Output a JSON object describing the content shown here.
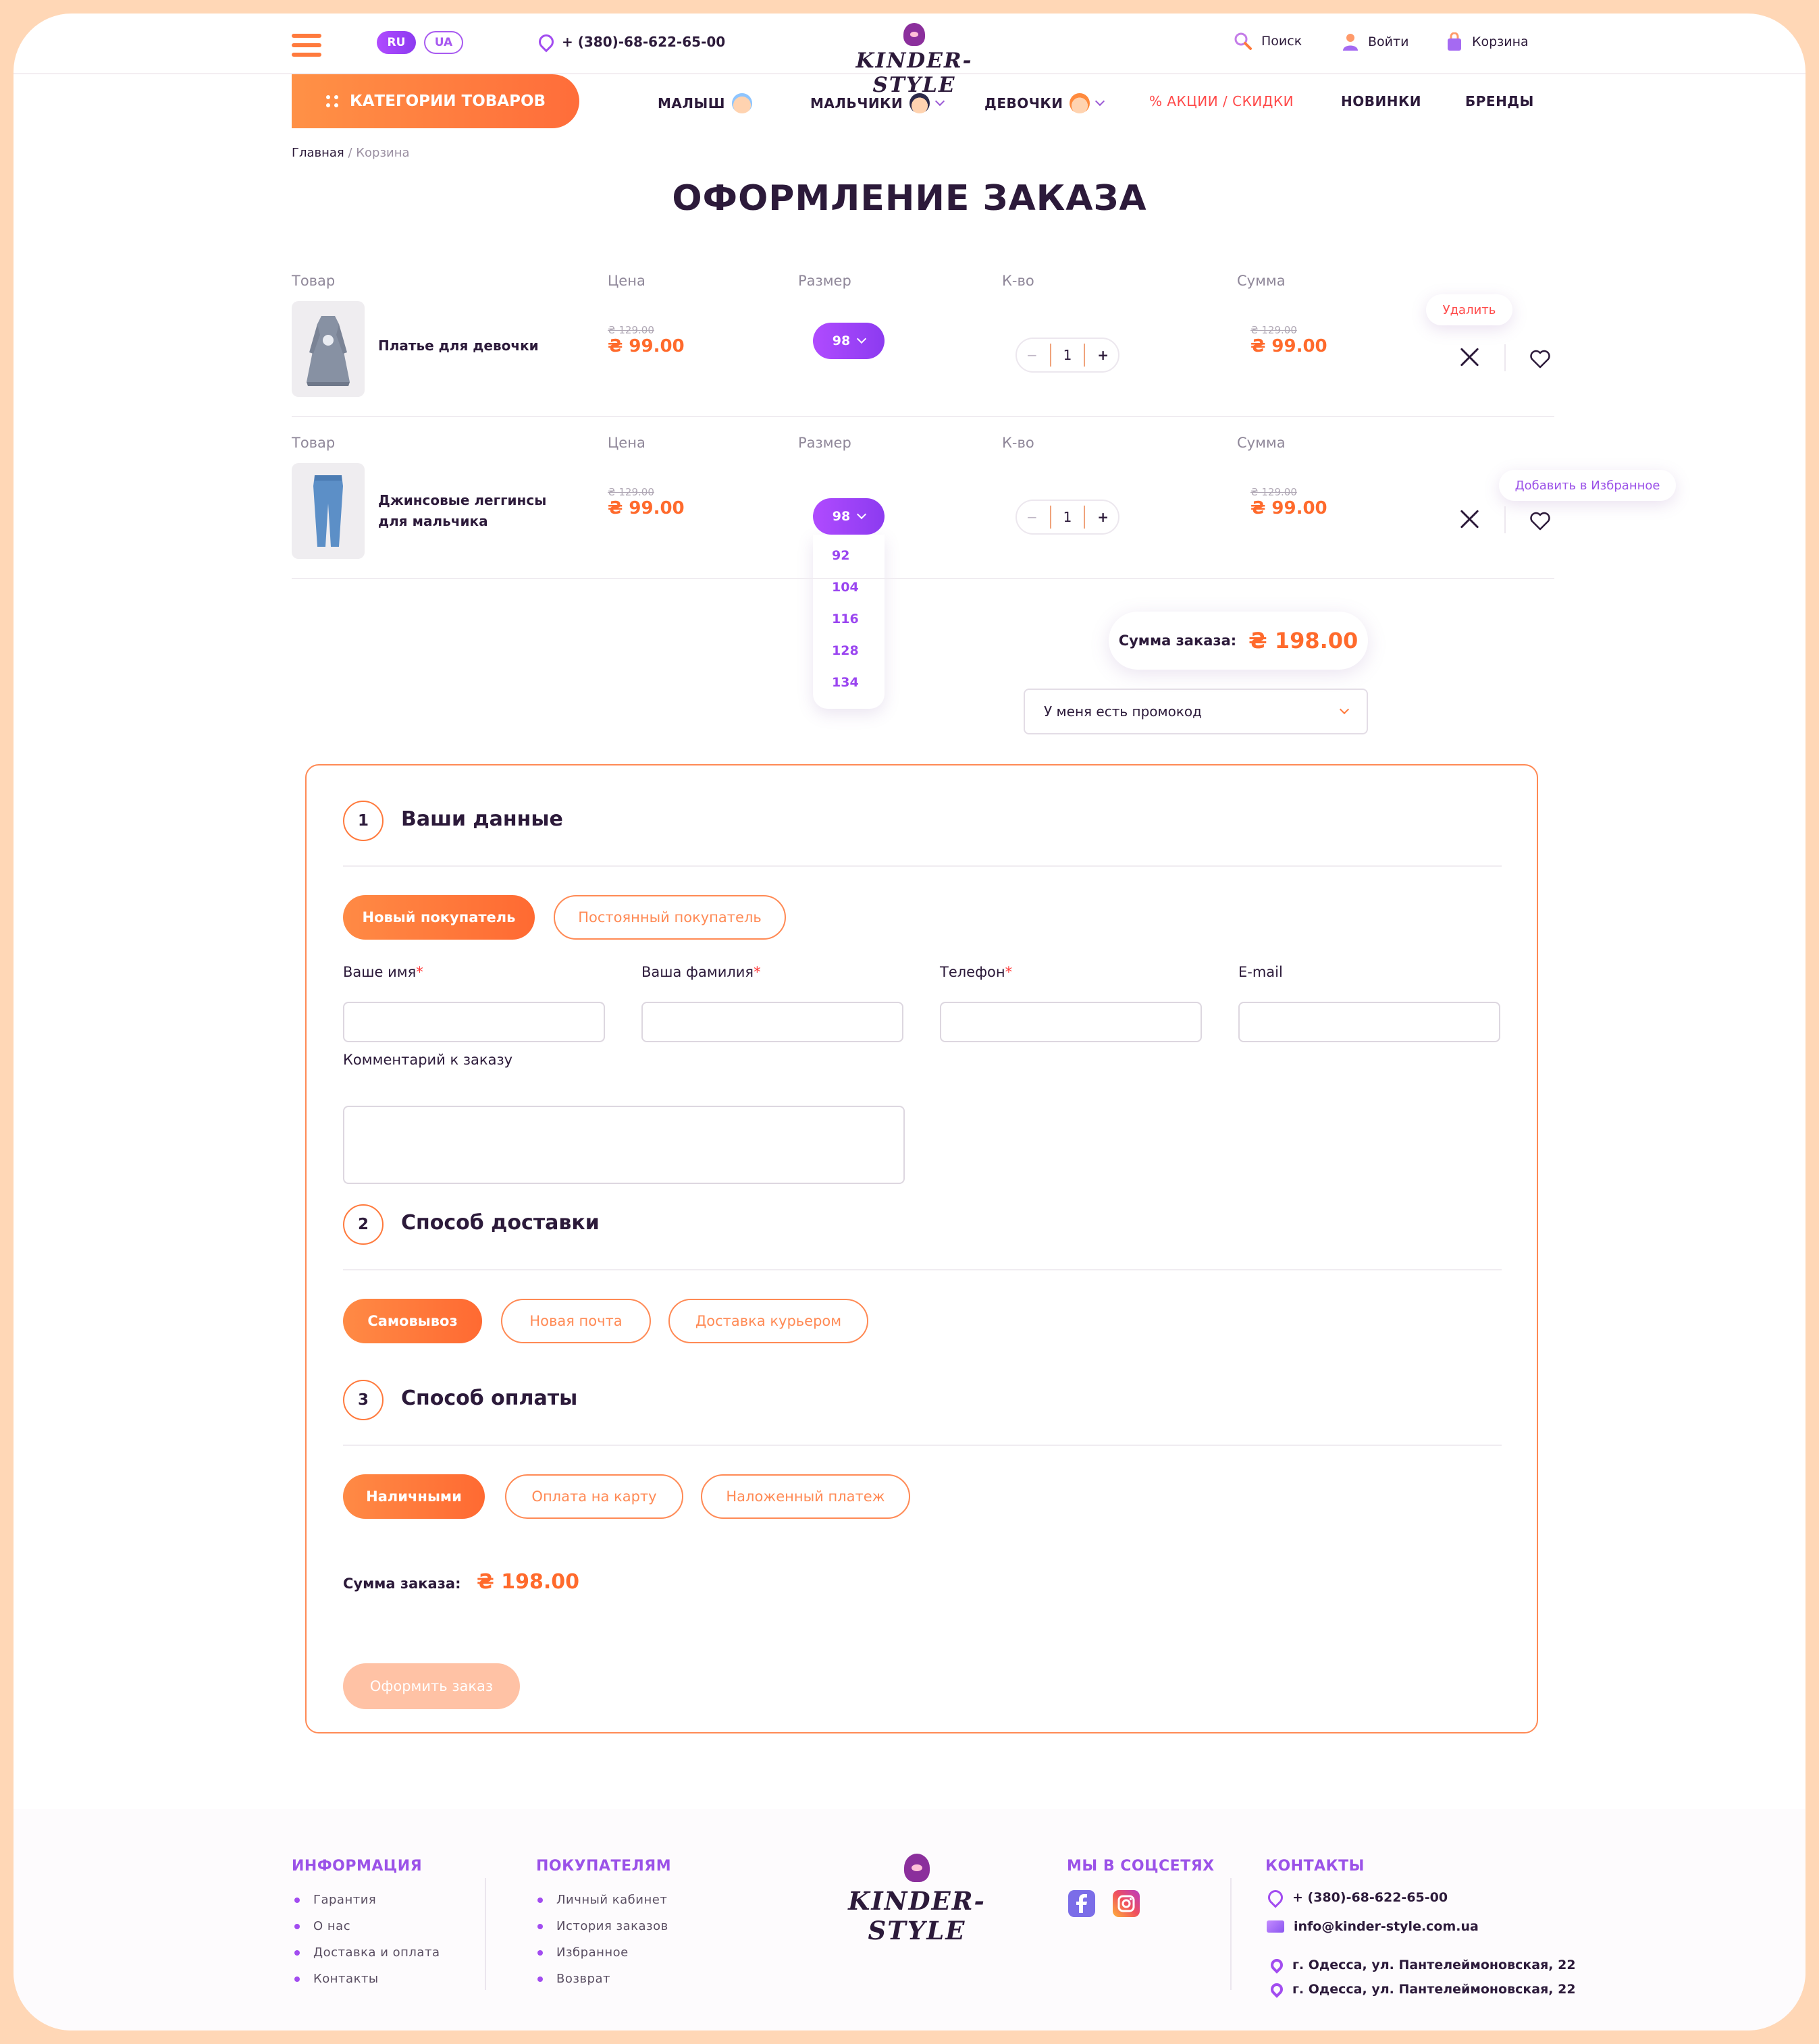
{
  "header": {
    "languages": [
      "RU",
      "UA"
    ],
    "phone": "+ (380)-68-622-65-00",
    "logo": "KINDER-STYLE",
    "search": "Поиск",
    "login": "Войти",
    "cart": "Корзина"
  },
  "nav": {
    "categories": "КАТЕГОРИИ ТОВАРОВ",
    "items": [
      "МАЛЫШ",
      "МАЛЬЧИКИ",
      "ДЕВОЧКИ",
      "% АКЦИИ / СКИДКИ",
      "НОВИНКИ",
      "БРЕНДЫ"
    ]
  },
  "breadcrumb": {
    "home": "Главная",
    "separator": " / ",
    "current": "Корзина"
  },
  "page_title": "ОФОРМЛЕНИЕ ЗАКАЗА",
  "cart": {
    "columns": [
      "Товар",
      "Цена",
      "Размер",
      "К-во",
      "Сумма"
    ],
    "items": [
      {
        "name": "Платье для девочки",
        "old_price": "₴ 129.00",
        "price": "₴ 99.00",
        "size": "98",
        "qty": "1",
        "old_sum": "₴ 129.00",
        "sum": "₴ 99.00"
      },
      {
        "name_line1": "Джинсовые леггинсы",
        "name_line2": "для мальчика",
        "old_price": "₴ 129.00",
        "price": "₴ 99.00",
        "size": "98",
        "qty": "1",
        "old_sum": "₴ 129.00",
        "sum": "₴ 99.00"
      }
    ],
    "size_options": [
      "92",
      "104",
      "116",
      "128",
      "134"
    ],
    "tooltip_delete": "Удалить",
    "tooltip_favorite": "Добавить в Избранное",
    "qty_minus": "−",
    "qty_plus": "+"
  },
  "summary": {
    "label": "Сумма заказа:",
    "value": "₴ 198.00",
    "promo": "У меня есть промокод"
  },
  "checkout": {
    "step1": {
      "num": "1",
      "title": "Ваши данные",
      "new_buyer": "Новый покупатель",
      "regular_buyer": "Постоянный покупатель"
    },
    "fields": {
      "first_name": "Ваше имя",
      "last_name": "Ваша фамилия",
      "phone": "Телефон",
      "email": "E-mail",
      "comment": "Комментарий к заказу",
      "required_mark": "*"
    },
    "step2": {
      "num": "2",
      "title": "Способ доставки",
      "options": [
        "Самовывоз",
        "Новая почта",
        "Доставка курьером"
      ]
    },
    "step3": {
      "num": "3",
      "title": "Способ оплаты",
      "options": [
        "Наличными",
        "Оплата на карту",
        "Наложенный платеж"
      ]
    },
    "total_label": "Сумма заказа:",
    "total_value": "₴ 198.00",
    "submit": "Оформить заказ"
  },
  "footer": {
    "info": {
      "title": "ИНФОРМАЦИЯ",
      "links": [
        "Гарантия",
        "О нас",
        "Доставка и оплата",
        "Контакты"
      ]
    },
    "buyers": {
      "title": "ПОКУПАТЕЛЯМ",
      "links": [
        "Личный кабинет",
        "История заказов",
        "Избранное",
        "Возврат"
      ]
    },
    "logo": "KINDER-STYLE",
    "social": {
      "title": "МЫ В СОЦСЕТЯХ"
    },
    "contacts": {
      "title": "КОНТАКТЫ",
      "phone": "+ (380)-68-622-65-00",
      "email": "info@kinder-style.com.ua",
      "address1": "г. Одесса, ул. Пантелеймоновская, 22",
      "address2": "г. Одесса, ул. Пантелеймоновская, 22"
    }
  },
  "colors": {
    "accent": "#ff6a2c",
    "purple": "#9b52e8",
    "text": "#2c1a3a"
  }
}
